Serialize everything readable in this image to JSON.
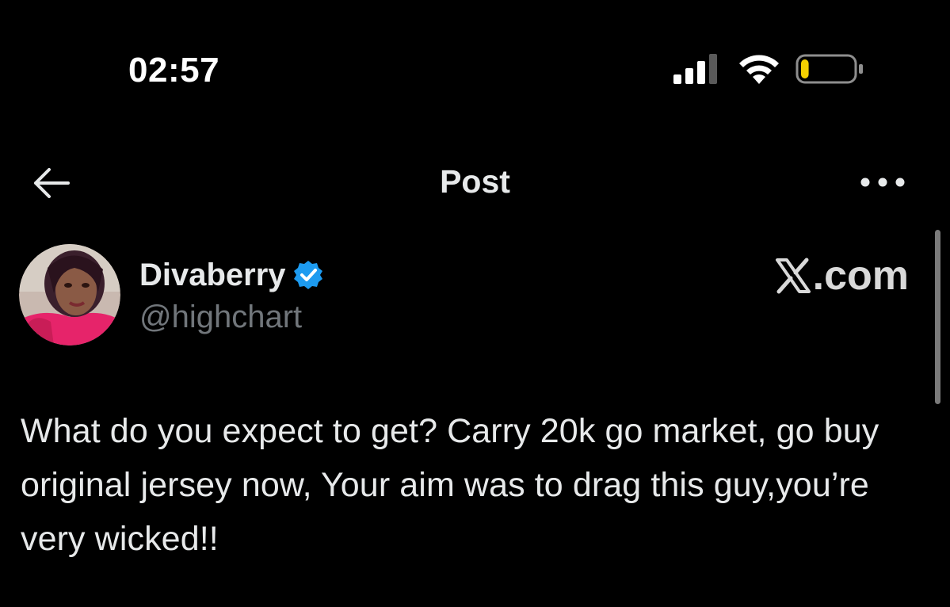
{
  "status_bar": {
    "time": "02:57",
    "signal_icon": "cellular-signal-icon",
    "wifi_icon": "wifi-icon",
    "battery_icon": "battery-low-icon",
    "battery_level": 0.15,
    "battery_color": "#f5d000"
  },
  "nav": {
    "back_icon": "back-arrow-icon",
    "title": "Post",
    "more_icon": "more-horizontal-icon"
  },
  "author": {
    "display_name": "Divaberry",
    "handle": "@highchart",
    "verified_icon": "verified-badge-icon",
    "verified_color": "#1d9bf0"
  },
  "watermark": {
    "logo": "x-logo",
    "text": ".com"
  },
  "post": {
    "text": "What do you expect to get? Carry 20k go market, go buy original jersey now, Your aim was to drag this guy,you’re very wicked!!"
  },
  "theme": {
    "background": "#000000",
    "text_primary": "#e7e9ea",
    "text_secondary": "#71767b"
  }
}
